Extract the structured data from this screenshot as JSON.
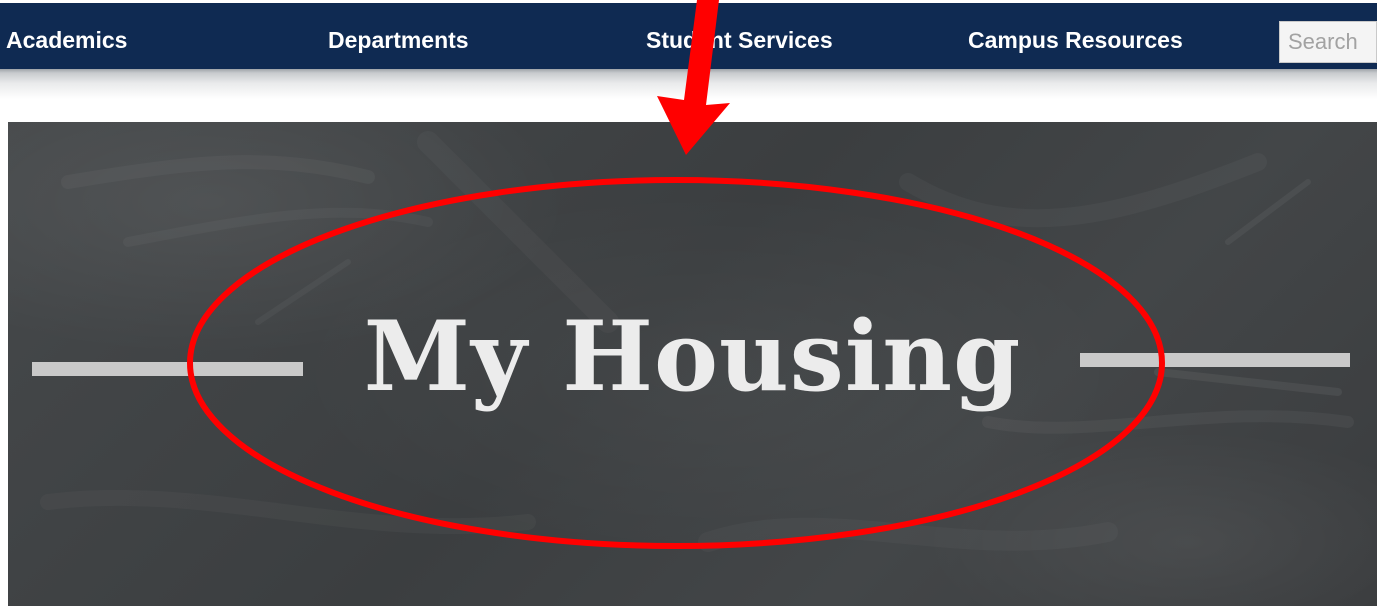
{
  "nav": {
    "items": [
      {
        "label": "Academics"
      },
      {
        "label": "Departments"
      },
      {
        "label": "Student Services"
      },
      {
        "label": "Campus Resources"
      }
    ],
    "search": {
      "placeholder": "Search"
    }
  },
  "hero": {
    "title": "My Housing"
  },
  "colors": {
    "nav_background": "#0f2a52",
    "nav_text": "#ffffff",
    "chalkboard": "#414446",
    "hero_text": "#ececec",
    "annotation": "#ff0000"
  },
  "annotation": {
    "shapes": [
      "arrow",
      "ellipse"
    ]
  }
}
